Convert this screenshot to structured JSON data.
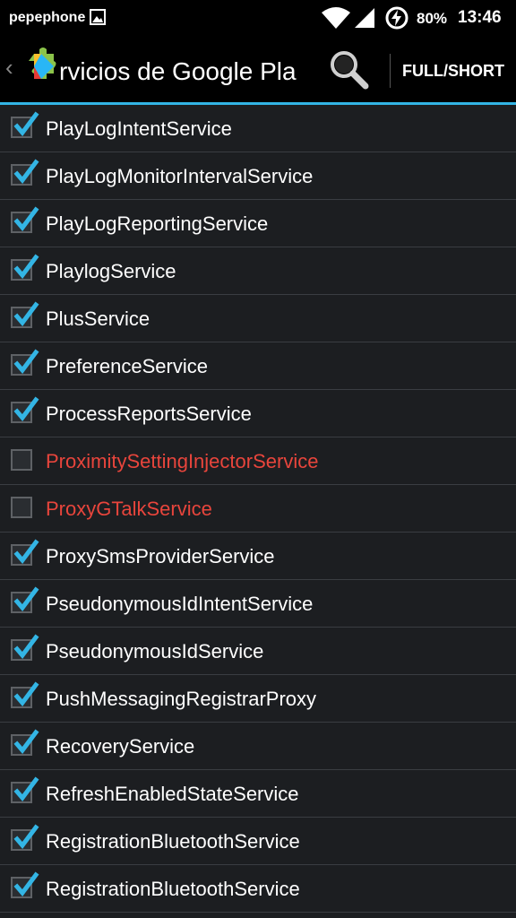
{
  "status_bar": {
    "carrier": "pepephone",
    "battery": "80%",
    "time": "13:46"
  },
  "action_bar": {
    "title": "rvicios de Google Pla",
    "full_short_label": "FULL/SHORT"
  },
  "colors": {
    "accent": "#33b5e5",
    "disabled_text": "#e8453c",
    "enabled_text": "#ffffff"
  },
  "services": [
    {
      "name": "PlayLogIntentService",
      "checked": true
    },
    {
      "name": "PlayLogMonitorIntervalService",
      "checked": true
    },
    {
      "name": "PlayLogReportingService",
      "checked": true
    },
    {
      "name": "PlaylogService",
      "checked": true
    },
    {
      "name": "PlusService",
      "checked": true
    },
    {
      "name": "PreferenceService",
      "checked": true
    },
    {
      "name": "ProcessReportsService",
      "checked": true
    },
    {
      "name": "ProximitySettingInjectorService",
      "checked": false
    },
    {
      "name": "ProxyGTalkService",
      "checked": false
    },
    {
      "name": "ProxySmsProviderService",
      "checked": true
    },
    {
      "name": "PseudonymousIdIntentService",
      "checked": true
    },
    {
      "name": "PseudonymousIdService",
      "checked": true
    },
    {
      "name": "PushMessagingRegistrarProxy",
      "checked": true
    },
    {
      "name": "RecoveryService",
      "checked": true
    },
    {
      "name": "RefreshEnabledStateService",
      "checked": true
    },
    {
      "name": "RegistrationBluetoothService",
      "checked": true
    },
    {
      "name": "RegistrationBluetoothService",
      "checked": true
    }
  ]
}
